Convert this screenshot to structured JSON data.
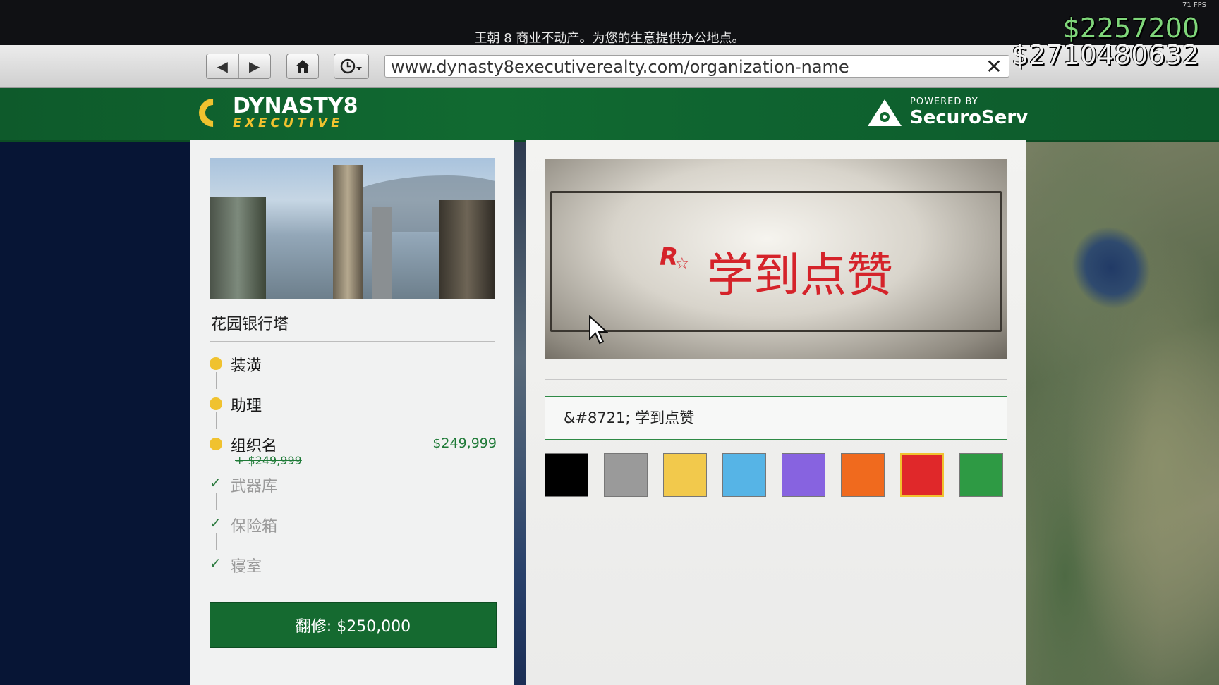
{
  "overlay": {
    "fps": "71 FPS",
    "caption": "王朝 8 商业不动产。为您的生意提供办公地点。",
    "cash": "$2257200",
    "bank": "$2710480632"
  },
  "browser": {
    "url": "www.dynasty8executiverealty.com/organization-name",
    "back_glyph": "◀",
    "forward_glyph": "▶",
    "home_glyph": "⌂",
    "history_glyph": "◷▾",
    "close_glyph": "✕"
  },
  "header": {
    "logo_line1": "DYNASTY8",
    "logo_line2": "EXECUTIVE",
    "powered_by": "POWERED BY",
    "securoserv": "SecuroServ"
  },
  "left_panel": {
    "building_name": "花园银行塔",
    "steps": [
      {
        "label": "装潢",
        "state": "current"
      },
      {
        "label": "助理",
        "state": "current"
      },
      {
        "label": "组织名",
        "state": "current",
        "price": "$249,999",
        "sub_price": "+ $249,999"
      },
      {
        "label": "武器库",
        "state": "done"
      },
      {
        "label": "保险箱",
        "state": "done"
      },
      {
        "label": "寝室",
        "state": "done"
      }
    ],
    "renovate_button": "翻修: $250,000"
  },
  "right_panel": {
    "sign_logo": "R",
    "sign_logo_star": "☆",
    "sign_text": "学到点赞",
    "name_input_value": "&#8721; 学到点赞",
    "swatches": [
      {
        "color": "#000000",
        "selected": false
      },
      {
        "color": "#9a9a9a",
        "selected": false
      },
      {
        "color": "#f2c94c",
        "selected": false
      },
      {
        "color": "#56b4e6",
        "selected": false
      },
      {
        "color": "#8763e0",
        "selected": false
      },
      {
        "color": "#f06a1e",
        "selected": false
      },
      {
        "color": "#e0282a",
        "selected": true
      },
      {
        "color": "#2e9a44",
        "selected": false
      }
    ]
  },
  "colors": {
    "accent_green": "#156a30",
    "brand_yellow": "#f0c22f",
    "sign_red": "#d5232a"
  }
}
